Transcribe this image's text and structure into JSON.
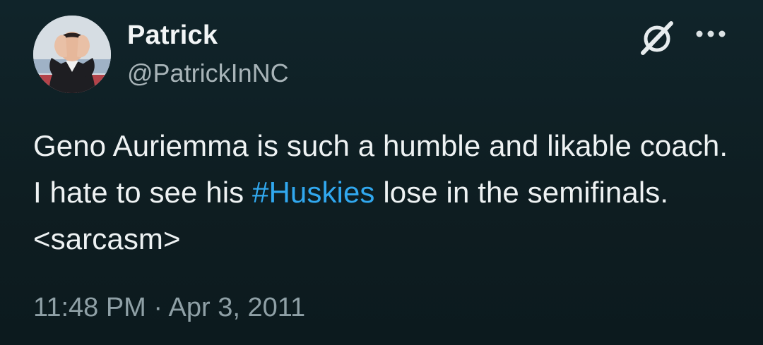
{
  "author": {
    "display_name": "Patrick",
    "handle": "@PatrickInNC"
  },
  "icons": {
    "avatar": "avatar-photo-person-covering-face",
    "grok": "grok-slash-circle-icon",
    "more": "more-options-ellipsis-icon"
  },
  "tweet": {
    "text_before": "Geno Auriemma is such a humble and likable coach. I hate to see his ",
    "hashtag": "#Huskies",
    "text_after": " lose in the semifinals. <sarcasm>",
    "time": "11:48 PM",
    "separator": "·",
    "date": "Apr 3, 2011"
  },
  "colors": {
    "background": "#0f1f23",
    "hashtag": "#31a8ef",
    "secondary_text": "#8fa0a6"
  }
}
